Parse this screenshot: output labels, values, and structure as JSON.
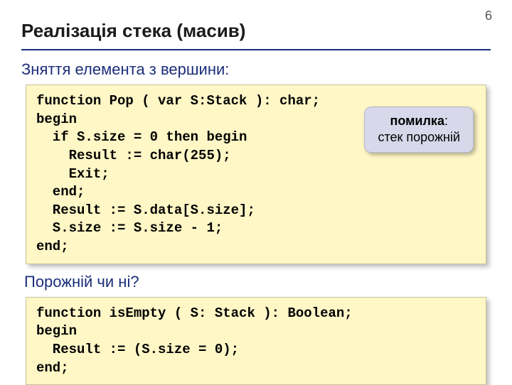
{
  "page_number": "6",
  "title": "Реалізація стека (масив)",
  "section1_title": "Зняття елемента з вершини:",
  "code1": "function Pop ( var S:Stack ): char;\nbegin\n  if S.size = 0 then begin\n    Result := char(255);\n    Exit;\n  end;\n  Result := S.data[S.size];\n  S.size := S.size - 1;\nend;",
  "callout_line1": "помилка",
  "callout_sep": ":",
  "callout_line2": "стек порожній",
  "section2_title": "Порожній чи ні?",
  "code2": "function isEmpty ( S: Stack ): Boolean;\nbegin\n  Result := (S.size = 0);\nend;"
}
